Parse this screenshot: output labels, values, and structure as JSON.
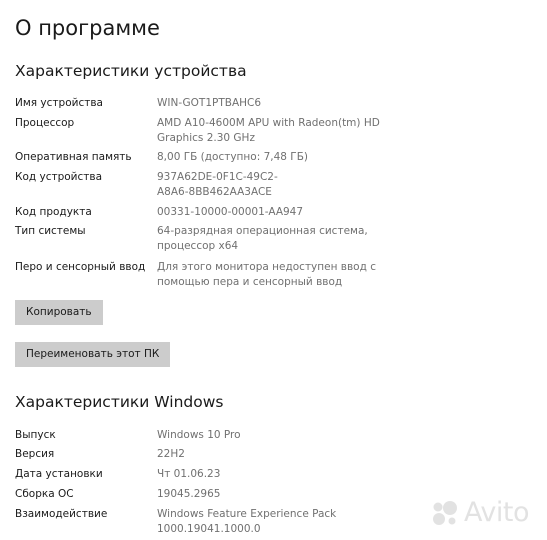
{
  "page": {
    "title": "О программе"
  },
  "device": {
    "heading": "Характеристики устройства",
    "rows": [
      {
        "label": "Имя устройства",
        "value": "WIN-GOT1PTBAHC6"
      },
      {
        "label": "Процессор",
        "value": "AMD A10-4600M APU with Radeon(tm) HD\nGraphics     2.30 GHz"
      },
      {
        "label": "Оперативная память",
        "value": "8,00 ГБ (доступно: 7,48 ГБ)"
      },
      {
        "label": "Код устройства",
        "value": "937A62DE-0F1C-49C2-\nA8A6-8BB462AA3ACE"
      },
      {
        "label": "Код продукта",
        "value": "00331-10000-00001-AA947"
      },
      {
        "label": "Тип системы",
        "value": "64-разрядная операционная система,\nпроцессор x64"
      },
      {
        "label": "Перо и сенсорный ввод",
        "value": "Для этого монитора недоступен ввод с\nпомощью пера и сенсорный ввод"
      }
    ],
    "copy_label": "Копировать",
    "rename_label": "Переименовать этот ПК"
  },
  "windows": {
    "heading": "Характеристики Windows",
    "rows": [
      {
        "label": "Выпуск",
        "value": "Windows 10 Pro"
      },
      {
        "label": "Версия",
        "value": "22H2"
      },
      {
        "label": "Дата установки",
        "value": "Чт 01.06.23"
      },
      {
        "label": "Сборка ОС",
        "value": "19045.2965"
      },
      {
        "label": "Взаимодействие",
        "value": "Windows Feature Experience Pack\n1000.19041.1000.0"
      }
    ]
  },
  "watermark": {
    "text": "Avito",
    "icon": "avito-logo-icon"
  },
  "colors": {
    "button_bg": "#cccccc",
    "value_text": "#707070",
    "label_text": "#1a1a1a"
  }
}
